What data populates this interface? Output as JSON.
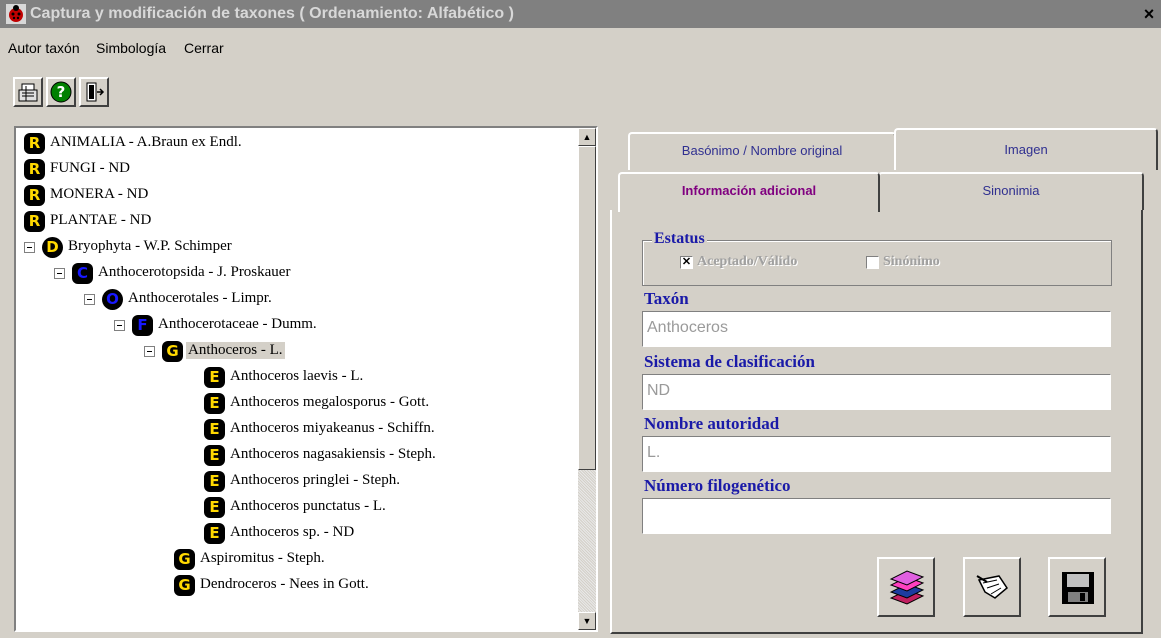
{
  "window": {
    "title": "Captura y modificación de taxones  ( Ordenamiento: Alfabético )",
    "close_glyph": "×"
  },
  "menu": [
    "Autor taxón",
    "Simbología",
    "Cerrar"
  ],
  "toolbar": {
    "icons": [
      "cash-register-icon",
      "help-icon",
      "exit-icon"
    ],
    "help_glyph": "?"
  },
  "tree": {
    "items": [
      {
        "badge": "R",
        "label": "ANIMALIA - A.Braun ex Endl."
      },
      {
        "badge": "R",
        "label": "FUNGI - ND"
      },
      {
        "badge": "R",
        "label": "MONERA - ND"
      },
      {
        "badge": "R",
        "label": "PLANTAE - ND"
      },
      {
        "badge": "D",
        "label": "Bryophyta - W.P. Schimper"
      },
      {
        "badge": "C",
        "label": "Anthocerotopsida - J. Proskauer"
      },
      {
        "badge": "O",
        "label": "Anthocerotales - Limpr."
      },
      {
        "badge": "F",
        "label": "Anthocerotaceae - Dumm."
      },
      {
        "badge": "G",
        "label": "Anthoceros - L."
      },
      {
        "badge": "E",
        "label": "Anthoceros laevis - L."
      },
      {
        "badge": "E",
        "label": "Anthoceros megalosporus - Gott."
      },
      {
        "badge": "E",
        "label": "Anthoceros miyakeanus - Schiffn."
      },
      {
        "badge": "E",
        "label": "Anthoceros nagasakiensis - Steph."
      },
      {
        "badge": "E",
        "label": "Anthoceros pringlei - Steph."
      },
      {
        "badge": "E",
        "label": "Anthoceros punctatus - L."
      },
      {
        "badge": "E",
        "label": "Anthoceros sp. - ND"
      },
      {
        "badge": "G",
        "label": "Aspiromitus - Steph."
      },
      {
        "badge": "G",
        "label": "Dendroceros - Nees in Gott."
      }
    ],
    "scroll_up": "▲",
    "scroll_down": "▼"
  },
  "tabs": {
    "back": [
      "Basónimo / Nombre original",
      "Imagen"
    ],
    "front": [
      "Información adicional",
      "Sinonimia"
    ]
  },
  "status": {
    "title": "Estatus",
    "accepted_label": "Aceptado/Válido",
    "accepted_checked": true,
    "accepted_mark": "✕",
    "synonym_label": "Sinónimo",
    "synonym_checked": false
  },
  "fields": {
    "taxon_label": "Taxón",
    "taxon_value": "Anthoceros",
    "system_label": "Sistema de clasificación",
    "system_value": "ND",
    "authority_label": "Nombre autoridad",
    "authority_value": "L.",
    "phylo_label": "Número filogenético",
    "phylo_value": ""
  },
  "colors": {
    "label_blue": "#1a1aa8",
    "active_tab": "#800080",
    "badge_yellow": "#ffd800",
    "badge_blue": "#1818ff"
  }
}
